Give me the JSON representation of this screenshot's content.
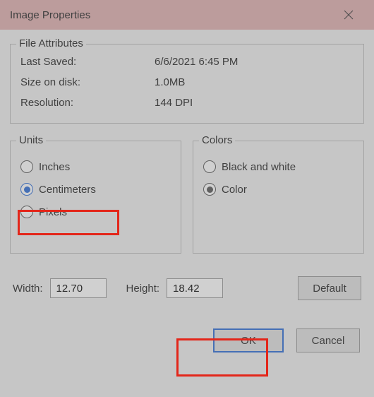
{
  "window": {
    "title": "Image Properties"
  },
  "fileAttributes": {
    "legend": "File Attributes",
    "lastSavedLabel": "Last Saved:",
    "lastSavedValue": "6/6/2021 6:45 PM",
    "sizeLabel": "Size on disk:",
    "sizeValue": "1.0MB",
    "resolutionLabel": "Resolution:",
    "resolutionValue": "144 DPI"
  },
  "units": {
    "legend": "Units",
    "inches": "Inches",
    "centimeters": "Centimeters",
    "pixels": "Pixels",
    "selected": "centimeters"
  },
  "colors": {
    "legend": "Colors",
    "bw": "Black and white",
    "color": "Color",
    "selected": "color"
  },
  "dimensions": {
    "widthLabel": "Width:",
    "widthValue": "12.70",
    "heightLabel": "Height:",
    "heightValue": "18.42",
    "defaultLabel": "Default"
  },
  "buttons": {
    "ok": "OK",
    "cancel": "Cancel"
  }
}
